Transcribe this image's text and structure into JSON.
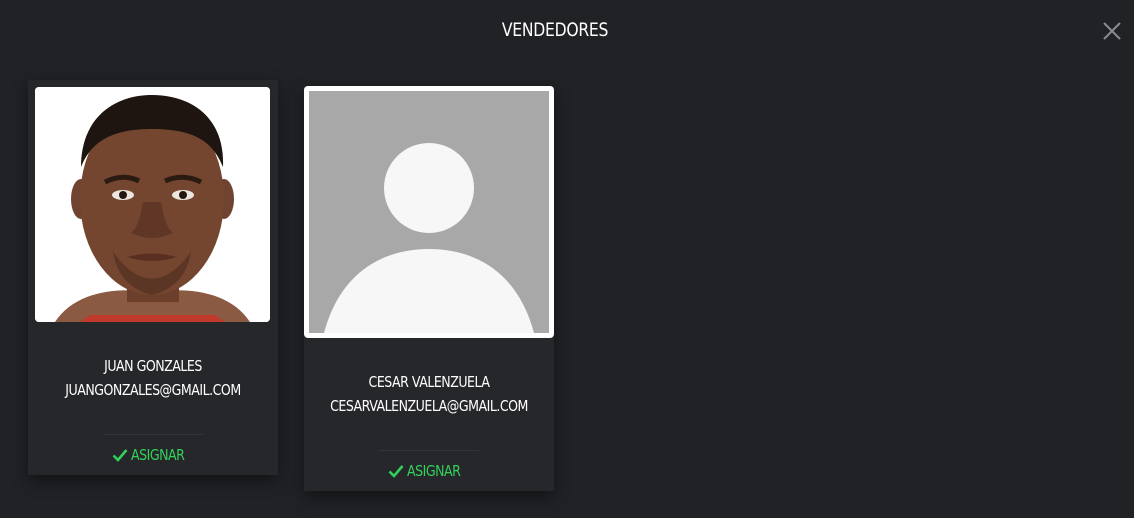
{
  "modal": {
    "title": "VENDEDORES"
  },
  "sellers": [
    {
      "name": "JUAN GONZALES",
      "email": "JUANGONZALES@GMAIL.COM",
      "assign_label": "ASIGNAR",
      "photo": "person-photo"
    },
    {
      "name": "CESAR VALENZUELA",
      "email": "CESARVALENZUELA@GMAIL.COM",
      "assign_label": "ASIGNAR",
      "photo": "default-avatar-placeholder"
    }
  ],
  "colors": {
    "background": "#212226",
    "card": "#26272b",
    "accent": "#33d15a",
    "text": "#ffffff"
  },
  "icons": {
    "close": "close-icon",
    "check": "check-icon"
  }
}
